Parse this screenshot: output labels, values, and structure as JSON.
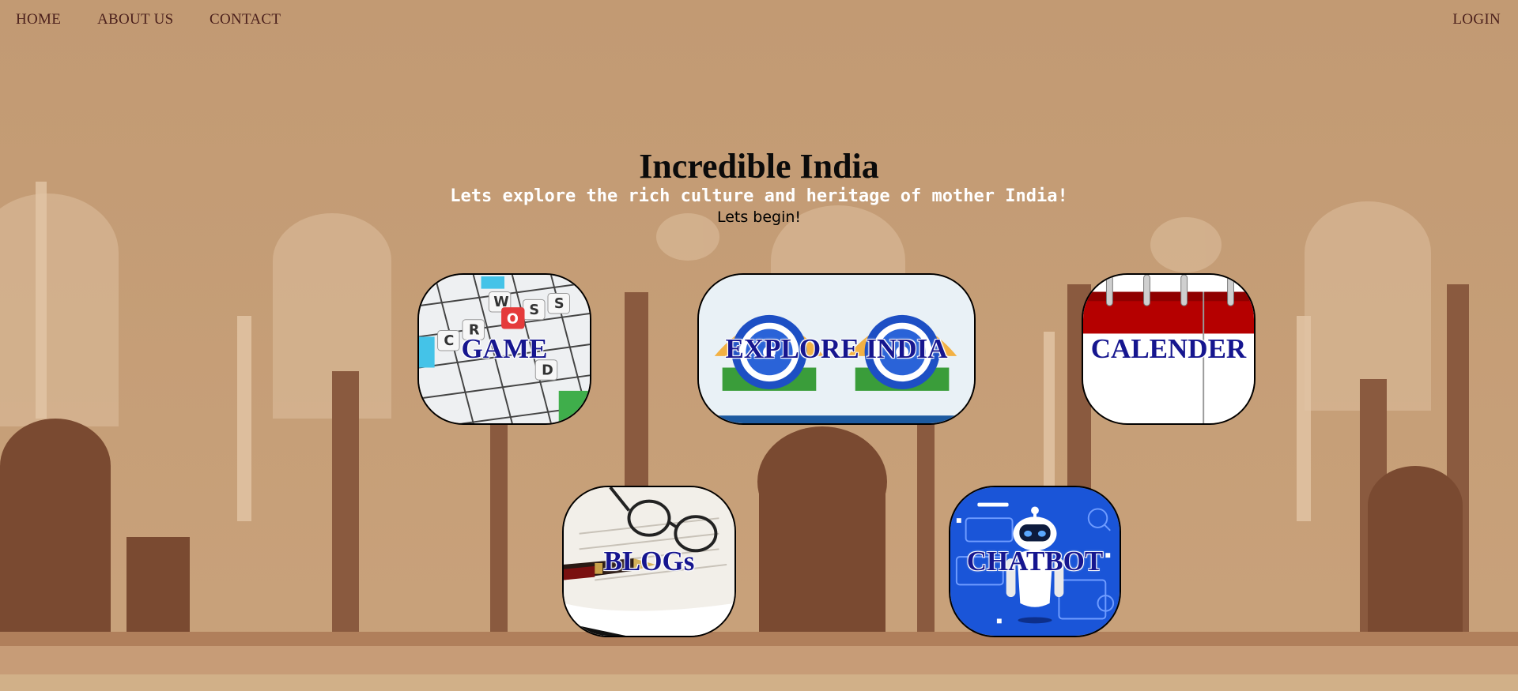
{
  "nav": {
    "home": "HOME",
    "about": "ABOUT US",
    "contact": "CONTACT",
    "login": "LOGIN"
  },
  "hero": {
    "title": "Incredible India",
    "subtitle": "Lets explore the rich culture and heritage of mother India!",
    "cta": "Lets begin!"
  },
  "tiles": {
    "game": {
      "label": "GAME",
      "icon": "crossword-icon"
    },
    "explore": {
      "label": "EXPLORE INDIA",
      "icon": "india-emblem-icon"
    },
    "calendar": {
      "label": "CALENDER",
      "icon": "calendar-icon"
    },
    "blogs": {
      "label": "BLOGs",
      "icon": "pen-paper-icon"
    },
    "chatbot": {
      "label": "CHATBOT",
      "icon": "robot-icon"
    }
  },
  "colors": {
    "background": "#c39c76",
    "nav_text": "#4a1f1b",
    "tile_label": "#16168f",
    "chatbot_bg": "#1a55d8",
    "calendar_red": "#b50000"
  }
}
